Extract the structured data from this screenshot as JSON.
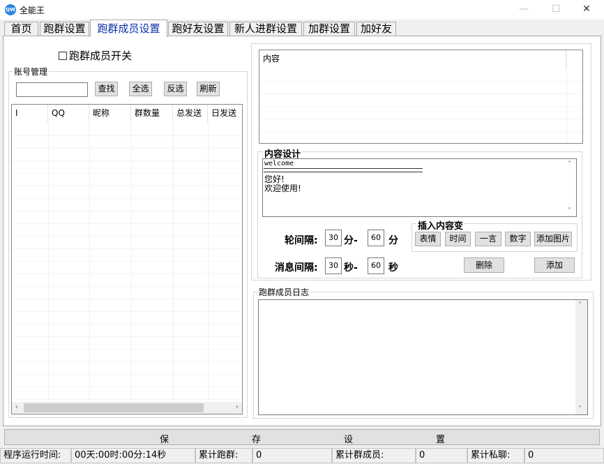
{
  "window": {
    "title": "全能王",
    "icon_text": "QW",
    "minimize": "—",
    "maximize": "☐",
    "close": "✕"
  },
  "tabs": [
    "首页",
    "跑群设置",
    "跑群成员设置",
    "跑好友设置",
    "新人进群设置",
    "加群设置",
    "加好友"
  ],
  "active_tab": 2,
  "left": {
    "toggle_label": "跑群成员开关",
    "account_group_title": "账号管理",
    "search_value": "",
    "buttons": {
      "find": "查找",
      "select_all": "全选",
      "invert": "反选",
      "refresh": "刷新"
    },
    "columns": [
      "I",
      "QQ",
      "昵称",
      "群数量",
      "总发送",
      "日发送"
    ]
  },
  "right": {
    "content_header": "内容",
    "design_title": "内容设计",
    "design_lines": [
      "welcome",
      "═══════════════════════════════",
      "",
      "您好!",
      "欢迎使用!"
    ],
    "interval_label": "轮间隔:",
    "interval_from": "30",
    "interval_sep": "分-",
    "interval_to": "60",
    "interval_unit": "分",
    "msg_interval_label": "消息间隔:",
    "msg_from": "30",
    "msg_sep": "秒-",
    "msg_to": "60",
    "msg_unit": "秒",
    "insert_group_title": "插入内容变",
    "insert_buttons": [
      "表情",
      "时间",
      "一言",
      "数字",
      "添加图片"
    ],
    "delete_button": "删除",
    "add_button": "添加",
    "log_title": "跑群成员日志"
  },
  "save_bar": [
    "保",
    "存",
    "设",
    "置"
  ],
  "status": {
    "runtime_label": "程序运行时间:",
    "runtime_value": "00天:00时:00分:14秒",
    "groups_label": "累计跑群:",
    "groups_value": "0",
    "members_label": "累计群成员:",
    "members_value": "0",
    "private_label": "累计私聊:",
    "private_value": "0"
  }
}
